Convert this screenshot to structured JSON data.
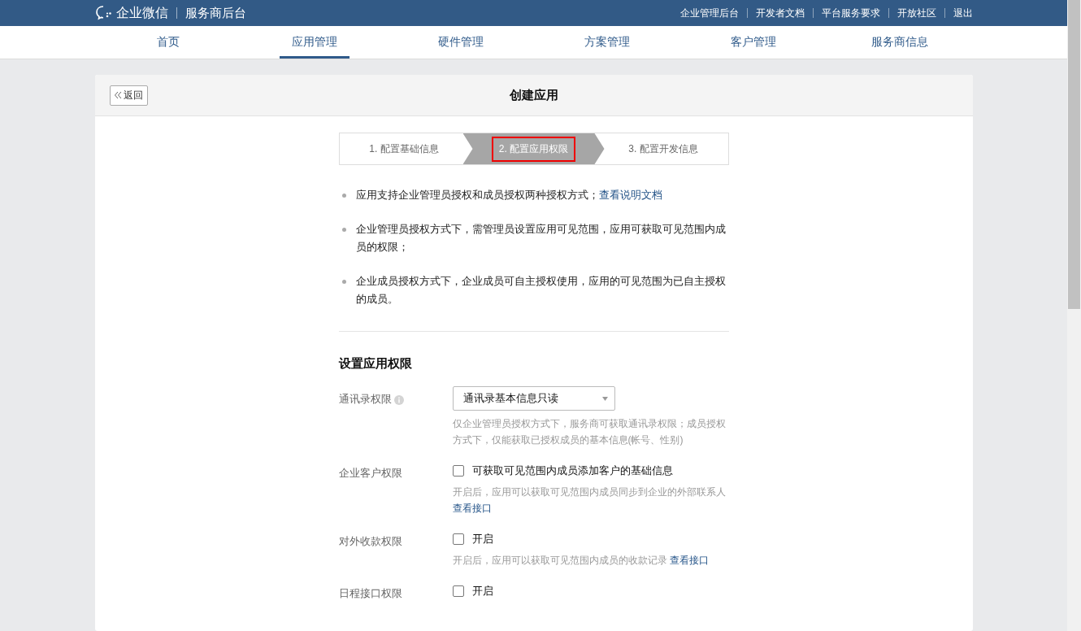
{
  "header": {
    "brand": "企业微信",
    "subtitle": "服务商后台",
    "links": [
      "企业管理后台",
      "开发者文档",
      "平台服务要求",
      "开放社区",
      "退出"
    ]
  },
  "nav": {
    "tabs": [
      {
        "label": "首页",
        "selected": false
      },
      {
        "label": "应用管理",
        "selected": true
      },
      {
        "label": "硬件管理",
        "selected": false
      },
      {
        "label": "方案管理",
        "selected": false
      },
      {
        "label": "客户管理",
        "selected": false
      },
      {
        "label": "服务商信息",
        "selected": false
      }
    ]
  },
  "card": {
    "back_button": "返回",
    "title": "创建应用"
  },
  "steps": [
    {
      "label": "1. 配置基础信息",
      "selected": false
    },
    {
      "label": "2. 配置应用权限",
      "selected": true
    },
    {
      "label": "3. 配置开发信息",
      "selected": false
    }
  ],
  "notes": [
    {
      "text": "应用支持企业管理员授权和成员授权两种授权方式；",
      "link": "查看说明文档"
    },
    {
      "text": "企业管理员授权方式下，需管理员设置应用可见范围，应用可获取可见范围内成员的权限；"
    },
    {
      "text": "企业成员授权方式下，企业成员可自主授权使用，应用的可见范围为已自主授权的成员。"
    }
  ],
  "section_title": "设置应用权限",
  "permissions": [
    {
      "kind": "select",
      "label": "通讯录权限",
      "info": true,
      "value": "通讯录基本信息只读",
      "help": "仅企业管理员授权方式下，服务商可获取通讯录权限；成员授权方式下，仅能获取已授权成员的基本信息(帐号、性别)"
    },
    {
      "kind": "checkbox",
      "label": "企业客户权限",
      "checked": false,
      "option": "可获取可见范围内成员添加客户的基础信息",
      "help": "开启后，应用可以获取可见范围内成员同步到企业的外部联系人 ",
      "link": "查看接口"
    },
    {
      "kind": "checkbox",
      "label": "对外收款权限",
      "checked": false,
      "option": "开启",
      "help": "开启后，应用可以获取可见范围内成员的收款记录 ",
      "link": "查看接口"
    },
    {
      "kind": "checkbox",
      "label": "日程接口权限",
      "checked": false,
      "option": "开启"
    }
  ]
}
